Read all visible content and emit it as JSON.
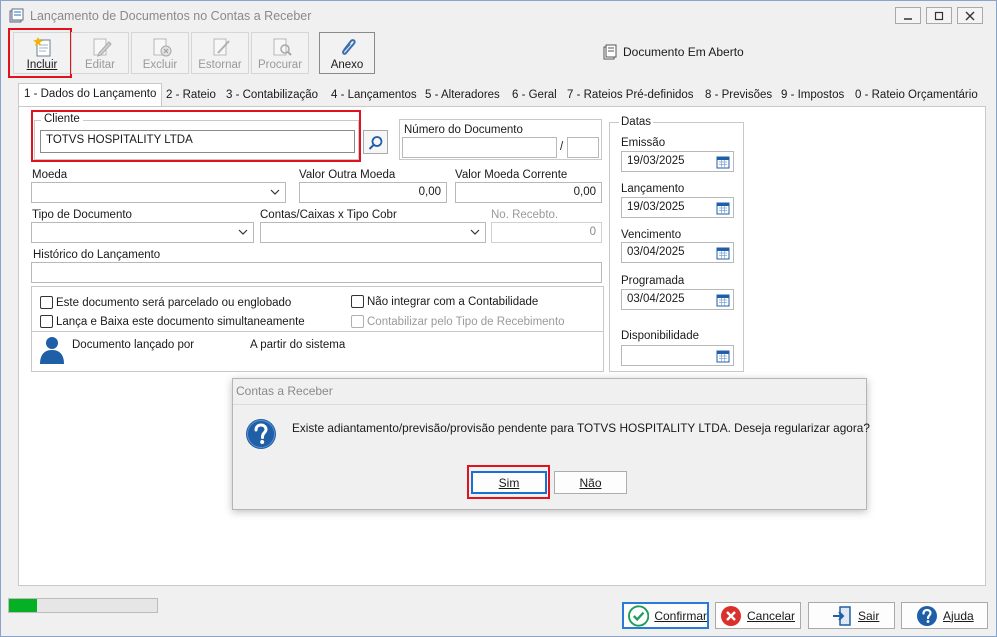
{
  "window": {
    "title": "Lançamento de Documentos no Contas a Receber",
    "status": "Documento Em Aberto"
  },
  "toolbar": {
    "incluir": "Incluir",
    "editar": "Editar",
    "excluir": "Excluir",
    "estornar": "Estornar",
    "procurar": "Procurar",
    "anexo": "Anexo"
  },
  "tabs": [
    "1 - Dados do Lançamento",
    "2 - Rateio",
    "3 - Contabilização",
    "4 - Lançamentos",
    "5 - Alteradores",
    "6 - Geral",
    "7 - Rateios Pré-definidos",
    "8 - Previsões",
    "9 - Impostos",
    "0 - Rateio Orçamentário"
  ],
  "form": {
    "cliente_label": "Cliente",
    "cliente_value": "TOTVS HOSPITALITY LTDA",
    "numero_label": "Número do Documento",
    "numero_sep": "/",
    "moeda_label": "Moeda",
    "valor_outra_label": "Valor Outra Moeda",
    "valor_outra_value": "0,00",
    "valor_corrente_label": "Valor Moeda Corrente",
    "valor_corrente_value": "0,00",
    "tipo_doc_label": "Tipo de Documento",
    "contas_label": "Contas/Caixas x Tipo Cobr",
    "no_recebto_label": "No. Recebto.",
    "no_recebto_value": "0",
    "historico_label": "Histórico do Lançamento",
    "chk_parcelado": "Este documento será parcelado ou englobado",
    "chk_lanca_baixa": "Lança e Baixa este documento simultaneamente",
    "chk_nao_integrar": "Não integrar com a Contabilidade",
    "chk_contabilizar": "Contabilizar pelo Tipo de Recebimento",
    "lancado_por_label": "Documento lançado por",
    "lancado_por_value": "A partir do sistema"
  },
  "datas": {
    "group_label": "Datas",
    "emissao_label": "Emissão",
    "emissao_value": "19/03/2025",
    "lancamento_label": "Lançamento",
    "lancamento_value": "19/03/2025",
    "vencimento_label": "Vencimento",
    "vencimento_value": "03/04/2025",
    "programada_label": "Programada",
    "programada_value": "03/04/2025",
    "disponibilidade_label": "Disponibilidade",
    "disponibilidade_value": ""
  },
  "dialog": {
    "title": "Contas a Receber",
    "message": "Existe adiantamento/previsão/provisão pendente para TOTVS HOSPITALITY LTDA. Deseja regularizar agora?",
    "sim": "Sim",
    "nao": "Não"
  },
  "footer": {
    "progress": 0.19,
    "confirmar": "Confirmar",
    "cancelar": "Cancelar",
    "sair": "Sair",
    "ajuda": "Ajuda"
  },
  "colors": {
    "highlight": "#e0121b",
    "progress": "#06b025",
    "icon_blue": "#1f5fa8",
    "confirm_green": "#1e9e5a",
    "cancel_red": "#d9302c"
  }
}
